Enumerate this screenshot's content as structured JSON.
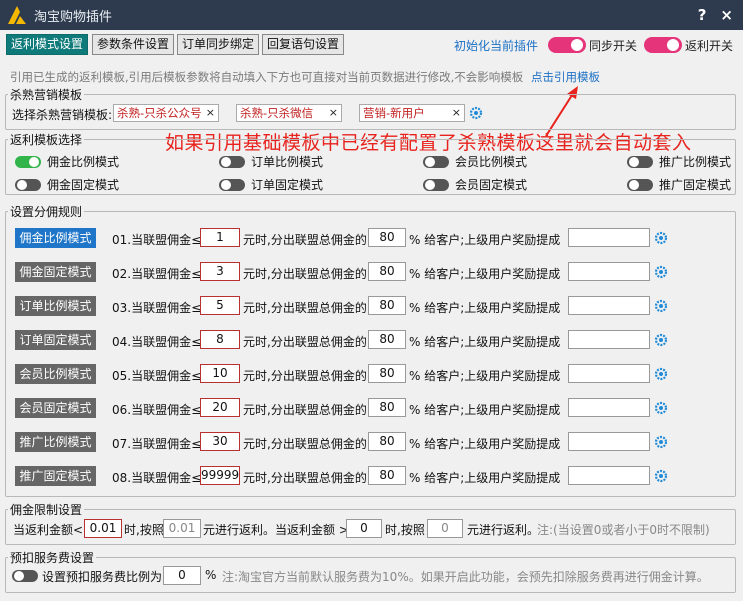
{
  "window": {
    "title": "淘宝购物插件",
    "help_label": "?",
    "close_label": "×"
  },
  "toolbar": {
    "tabs": [
      "返利模式设置",
      "参数条件设置",
      "订单同步绑定",
      "回复语句设置"
    ],
    "init_link": "初始化当前插件",
    "sync_switch_label": "同步开关",
    "rebate_switch_label": "返利开关"
  },
  "hint": {
    "text": "引用已生成的返利模板,引用后模板参数将自动填入下方也可直接对当前页数据进行修改,不会影响模板",
    "link": "点击引用模板"
  },
  "killfam": {
    "legend": "杀熟营销模板",
    "label": "选择杀熟营销模板:",
    "tags": [
      "杀熟-只杀公众号",
      "杀熟-只杀微信",
      "营销-新用户"
    ]
  },
  "annotation": {
    "text": "如果引用基础模板中已经有配置了杀熟模板这里就会自动套入"
  },
  "mode_select": {
    "legend": "返利模板选择",
    "options": [
      "佣金比例模式",
      "订单比例模式",
      "会员比例模式",
      "推广比例模式",
      "佣金固定模式",
      "订单固定模式",
      "会员固定模式",
      "推广固定模式"
    ]
  },
  "rules": {
    "legend": "设置分佣规则",
    "buttons": [
      "佣金比例模式",
      "佣金固定模式",
      "订单比例模式",
      "订单固定模式",
      "会员比例模式",
      "会员固定模式",
      "推广比例模式",
      "推广固定模式"
    ],
    "rows": [
      {
        "prefix": "01.当联盟佣金≤",
        "threshold": "1",
        "percent": "80"
      },
      {
        "prefix": "02.当联盟佣金≤",
        "threshold": "3",
        "percent": "80"
      },
      {
        "prefix": "03.当联盟佣金≤",
        "threshold": "5",
        "percent": "80"
      },
      {
        "prefix": "04.当联盟佣金≤",
        "threshold": "8",
        "percent": "80"
      },
      {
        "prefix": "05.当联盟佣金≤",
        "threshold": "10",
        "percent": "80"
      },
      {
        "prefix": "06.当联盟佣金≤",
        "threshold": "20",
        "percent": "80"
      },
      {
        "prefix": "07.当联盟佣金≤",
        "threshold": "30",
        "percent": "80"
      },
      {
        "prefix": "08.当联盟佣金≤",
        "threshold": "99999",
        "percent": "80"
      }
    ],
    "mid_text": "元时,分出联盟总佣金的",
    "suffix_text": "% 给客户;上级用户奖励提成"
  },
  "limit": {
    "legend": "佣金限制设置",
    "t1": "当返利金额<",
    "v1": "0.01",
    "t2": "时,按照",
    "v2": "0.01",
    "t3": "元进行返利。当返利金额 >",
    "v3": "0",
    "t4": "时,按照",
    "v4": "0",
    "t5": "元进行返利。",
    "note": "注:(当设置0或者小于0时不限制)"
  },
  "fee": {
    "legend": "预扣服务费设置",
    "label": "设置预扣服务费比例为",
    "value": "0",
    "pct": "%",
    "note": "注:淘宝官方当前默认服务费为10%。如果开启此功能，会预先扣除服务费再进行佣金计算。"
  }
}
